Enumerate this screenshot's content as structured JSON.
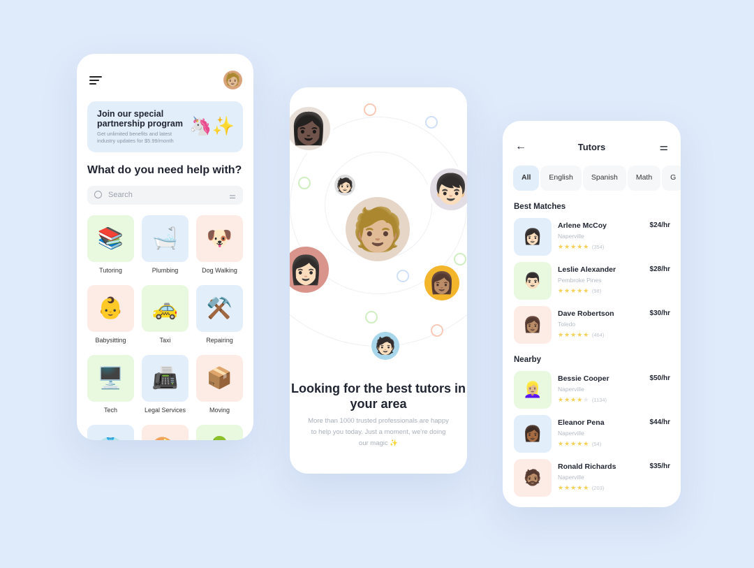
{
  "home": {
    "promo_title": "Join our special partnership program",
    "promo_text": "Get unlimited benefits and latest industry updates for $5.99/month",
    "promo_emoji": "🦄✨",
    "heading": "What do you need help with?",
    "search_placeholder": "Search",
    "categories": [
      {
        "label": "Tutoring",
        "icon": "📚",
        "bg": "g"
      },
      {
        "label": "Plumbing",
        "icon": "🛁",
        "bg": "b"
      },
      {
        "label": "Dog Walking",
        "icon": "🐶",
        "bg": "r"
      },
      {
        "label": "Babysitting",
        "icon": "👶",
        "bg": "r"
      },
      {
        "label": "Taxi",
        "icon": "🚕",
        "bg": "g"
      },
      {
        "label": "Repairing",
        "icon": "⚒️",
        "bg": "b"
      },
      {
        "label": "Tech",
        "icon": "🖥️",
        "bg": "g"
      },
      {
        "label": "Legal Services",
        "icon": "📠",
        "bg": "b"
      },
      {
        "label": "Moving",
        "icon": "📦",
        "bg": "r"
      },
      {
        "label": "",
        "icon": "👕",
        "bg": "b"
      },
      {
        "label": "",
        "icon": "🎨",
        "bg": "r"
      },
      {
        "label": "",
        "icon": "🌳",
        "bg": "g"
      }
    ]
  },
  "loading": {
    "title": "Looking for the best tutors in your area",
    "subtitle": "More than 1000 trusted professionals are happy to help you today. Just a moment, we're doing our magic ✨"
  },
  "tutors": {
    "title": "Tutors",
    "filters": [
      "All",
      "English",
      "Spanish",
      "Math",
      "G"
    ],
    "best_label": "Best Matches",
    "nearby_label": "Nearby",
    "best": [
      {
        "name": "Arlene McCoy",
        "city": "Naperville",
        "price": "$24/hr",
        "stars": 5,
        "reviews": "(354)",
        "icon": "👩🏻",
        "bg": "b"
      },
      {
        "name": "Leslie Alexander",
        "city": "Pembroke Pines",
        "price": "$28/hr",
        "stars": 5,
        "reviews": "(98)",
        "icon": "👨🏻",
        "bg": "g"
      },
      {
        "name": "Dave Robertson",
        "city": "Toledo",
        "price": "$30/hr",
        "stars": 5,
        "reviews": "(464)",
        "icon": "👩🏽",
        "bg": "r"
      }
    ],
    "nearby": [
      {
        "name": "Bessie Cooper",
        "city": "Naperville",
        "price": "$50/hr",
        "stars": 4,
        "reviews": "(1134)",
        "icon": "👱🏼‍♀️",
        "bg": "g"
      },
      {
        "name": "Eleanor Pena",
        "city": "Naperville",
        "price": "$44/hr",
        "stars": 5,
        "reviews": "(54)",
        "icon": "👩🏾",
        "bg": "b"
      },
      {
        "name": "Ronald Richards",
        "city": "Naperville",
        "price": "$35/hr",
        "stars": 5,
        "reviews": "(203)",
        "icon": "🧔🏽",
        "bg": "r"
      }
    ]
  }
}
